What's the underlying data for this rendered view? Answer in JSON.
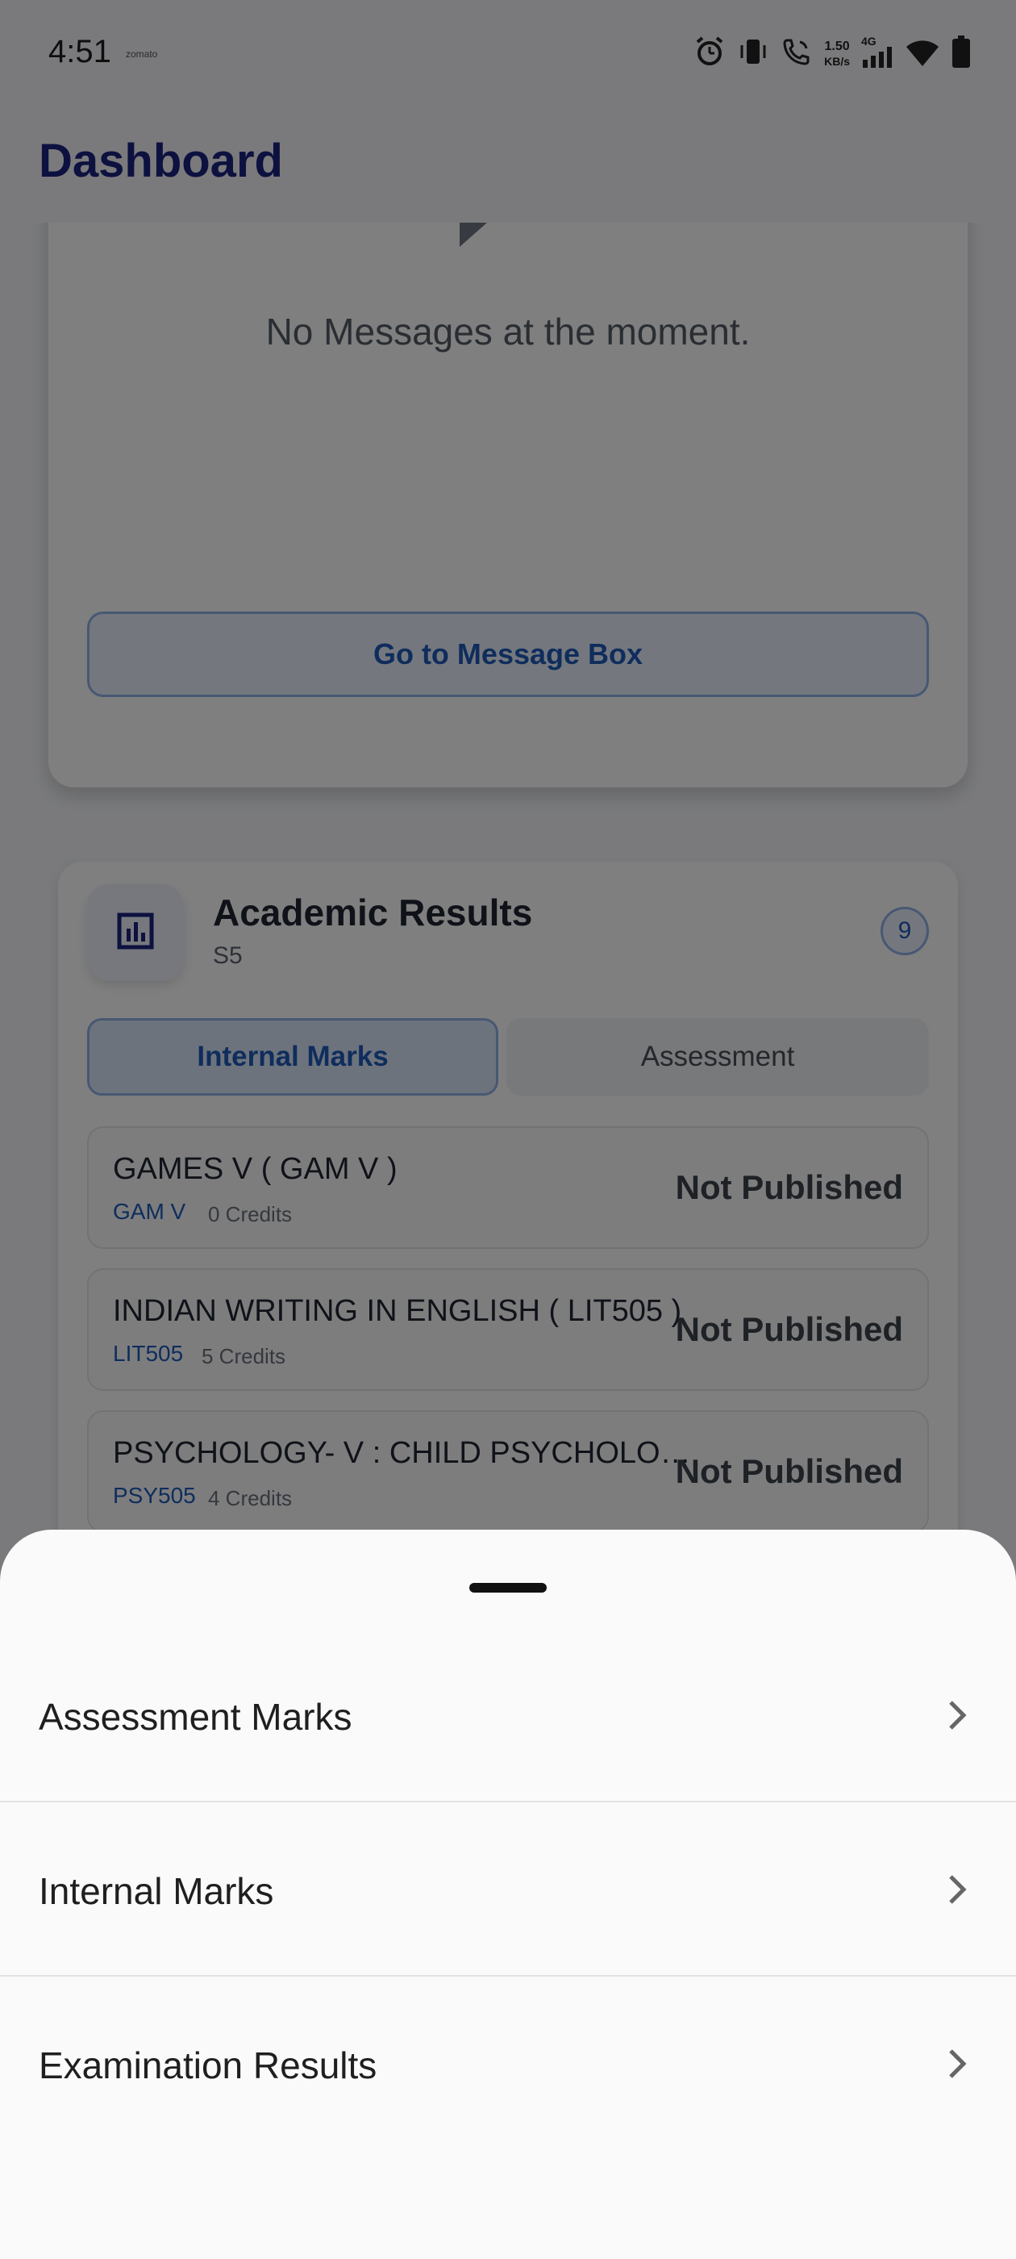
{
  "status_bar": {
    "time": "4:51",
    "mini_label": "zomato",
    "net_speed_value": "1.50",
    "net_speed_unit": "KB/s",
    "network_type": "4G",
    "icons": [
      "alarm-icon",
      "vibrate-icon",
      "wifi-call-icon",
      "signal-icon",
      "wifi-icon",
      "battery-icon"
    ]
  },
  "app_bar": {
    "title": "Dashboard"
  },
  "messages": {
    "empty_text": "No Messages at the moment.",
    "button_label": "Go to Message Box"
  },
  "results": {
    "title": "Academic Results",
    "subtitle": "S5",
    "count": "9",
    "tabs": [
      {
        "label": "Internal Marks",
        "active": true
      },
      {
        "label": "Assessment",
        "active": false
      }
    ],
    "subjects": [
      {
        "name": "GAMES V ( GAM V )",
        "code": "GAM V",
        "credits": "0 Credits",
        "status": "Not Published"
      },
      {
        "name": "INDIAN WRITING IN ENGLISH ( LIT505 )",
        "code": "LIT505",
        "credits": "5 Credits",
        "status": "Not Published"
      },
      {
        "name": "PSYCHOLOGY- V : CHILD PSYCHOLOGY...",
        "code": "PSY505",
        "credits": "4 Credits",
        "status": "Not Published"
      }
    ]
  },
  "sheet": {
    "items": [
      {
        "label": "Assessment Marks"
      },
      {
        "label": "Internal Marks"
      },
      {
        "label": "Examination Results"
      }
    ]
  },
  "colors": {
    "title_blue": "#1a237e",
    "accent_blue": "#1e5bb8",
    "scrim": "rgba(0,0,0,0.50)"
  }
}
